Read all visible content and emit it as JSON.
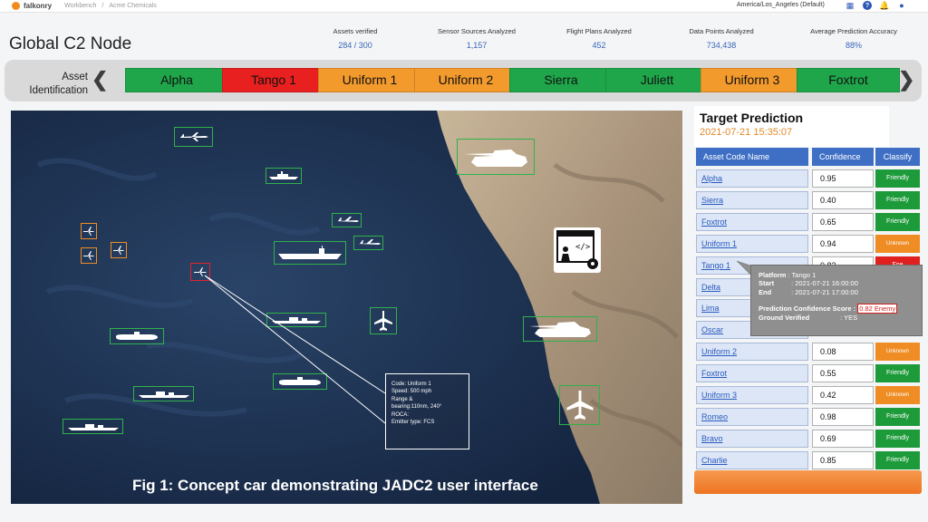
{
  "topbar": {
    "brand": "falkonry",
    "crumb1": "Workbench",
    "sep": "/",
    "crumb2": "Acme Chemicals",
    "timezone": "America/Los_Angeles (Default)",
    "icons": [
      "grid-icon",
      "help-icon",
      "bell-icon",
      "user-icon"
    ]
  },
  "header": {
    "title": "Global C2 Node",
    "stats": [
      {
        "label": "Assets verified",
        "value": "284 / 300"
      },
      {
        "label": "Sensor Sources Analyzed",
        "value": "1,157"
      },
      {
        "label": "Flight Plans Analyzed",
        "value": "452"
      },
      {
        "label": "Data Points Analyzed",
        "value": "734,438"
      },
      {
        "label": "Average Prediction Accuracy",
        "value": "88%"
      }
    ]
  },
  "strip": {
    "label_line1": "Asset",
    "label_line2": "Identification",
    "assets": [
      {
        "name": "Alpha",
        "color": "#1fa64a"
      },
      {
        "name": "Tango 1",
        "color": "#e8201f"
      },
      {
        "name": "Uniform 1",
        "color": "#f39a2d"
      },
      {
        "name": "Uniform 2",
        "color": "#f39a2d"
      },
      {
        "name": "Sierra",
        "color": "#1fa64a"
      },
      {
        "name": "Juliett",
        "color": "#1fa64a"
      },
      {
        "name": "Uniform 3",
        "color": "#f39a2d"
      },
      {
        "name": "Foxtrot",
        "color": "#1fa64a"
      }
    ]
  },
  "map": {
    "info": {
      "code": "Code: Uniform 1",
      "speed": "Speed: 500 mph",
      "range1": "Range &",
      "range2": "bearing:110nm, 240°",
      "roca": "ROCA:",
      "emitter": "Emitter type: FCS"
    },
    "caption": "Fig 1: Concept car demonstrating JADC2 user interface"
  },
  "prediction": {
    "title": "Target Prediction",
    "datetime": "2021-07-21 15:35:07",
    "headers": {
      "name": "Asset Code Name",
      "confidence": "Confidence",
      "classify": "Classify"
    },
    "rows": [
      {
        "name": "Alpha",
        "confidence": "0.95",
        "classify": "Friendly",
        "kind": "friendly"
      },
      {
        "name": "Sierra",
        "confidence": "0.40",
        "classify": "Friendly",
        "kind": "friendly"
      },
      {
        "name": "Foxtrot",
        "confidence": "0.65",
        "classify": "Friendly",
        "kind": "friendly"
      },
      {
        "name": "Uniform 1",
        "confidence": "0.94",
        "classify": "Unknown",
        "kind": "unknown"
      },
      {
        "name": "Tango 1",
        "confidence": "0.82",
        "classify": "Foe",
        "kind": "foe"
      },
      {
        "name": "Delta",
        "confidence": "",
        "classify": "",
        "kind": "none"
      },
      {
        "name": "Lima",
        "confidence": "",
        "classify": "",
        "kind": "none"
      },
      {
        "name": "Oscar",
        "confidence": "",
        "classify": "",
        "kind": "none"
      },
      {
        "name": "Uniform 2",
        "confidence": "0.08",
        "classify": "Unknown",
        "kind": "unknown"
      },
      {
        "name": "Foxtrot",
        "confidence": "0.55",
        "classify": "Friendly",
        "kind": "friendly"
      },
      {
        "name": "Uniform 3",
        "confidence": "0.42",
        "classify": "Unknown",
        "kind": "unknown"
      },
      {
        "name": "Romeo",
        "confidence": "0.98",
        "classify": "Friendly",
        "kind": "friendly"
      },
      {
        "name": "Bravo",
        "confidence": "0.69",
        "classify": "Friendly",
        "kind": "friendly"
      },
      {
        "name": "Charlie",
        "confidence": "0.85",
        "classify": "Friendly",
        "kind": "friendly"
      }
    ],
    "popup": {
      "platform_label": "Platform",
      "platform": ": Tango 1",
      "start_label": "Start",
      "start": ": 2021-07-21 16:00:00",
      "end_label": "End",
      "end": ": 2021-07-21 17:00:00",
      "score_label": "Prediction Confidence Score :",
      "score": "0.82 Enemy",
      "ground_label": "Ground Verified",
      "ground": ": YES"
    }
  }
}
